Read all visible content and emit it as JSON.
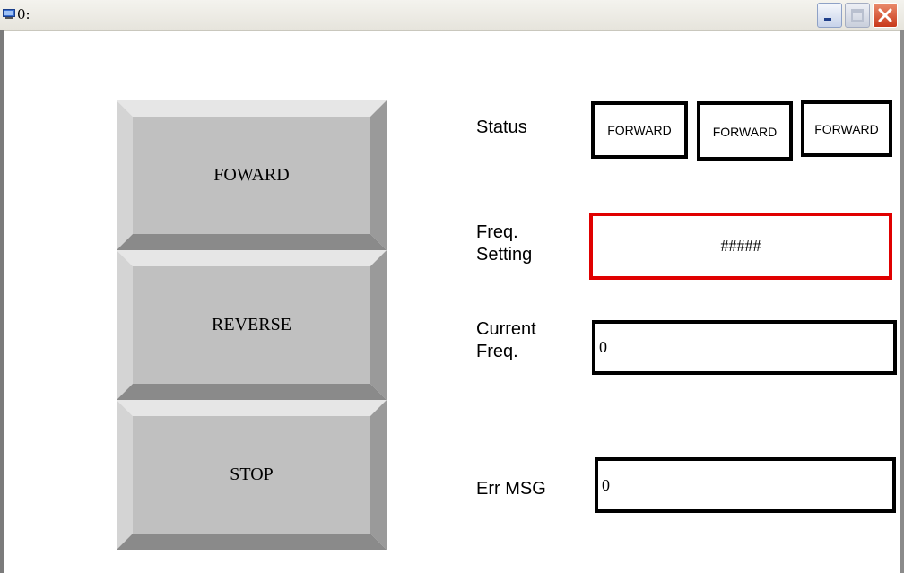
{
  "window": {
    "title": "0:",
    "icon": "monitor-icon"
  },
  "controls": {
    "minimize_icon": "minimize-icon",
    "maximize_icon": "maximize-icon",
    "close_icon": "close-icon",
    "close_color": "#d9462a"
  },
  "buttons": {
    "forward": "FOWARD",
    "reverse": "REVERSE",
    "stop": "STOP"
  },
  "status": {
    "label": "Status",
    "values": [
      "FORWARD",
      "FORWARD",
      "FORWARD"
    ]
  },
  "freq_setting": {
    "label_line1": "Freq.",
    "label_line2": "Setting",
    "value": "#####",
    "border_color": "#e00000"
  },
  "current_freq": {
    "label_line1": "Current",
    "label_line2": "Freq.",
    "value": "0"
  },
  "err_msg": {
    "label": "Err MSG",
    "value": "0"
  }
}
